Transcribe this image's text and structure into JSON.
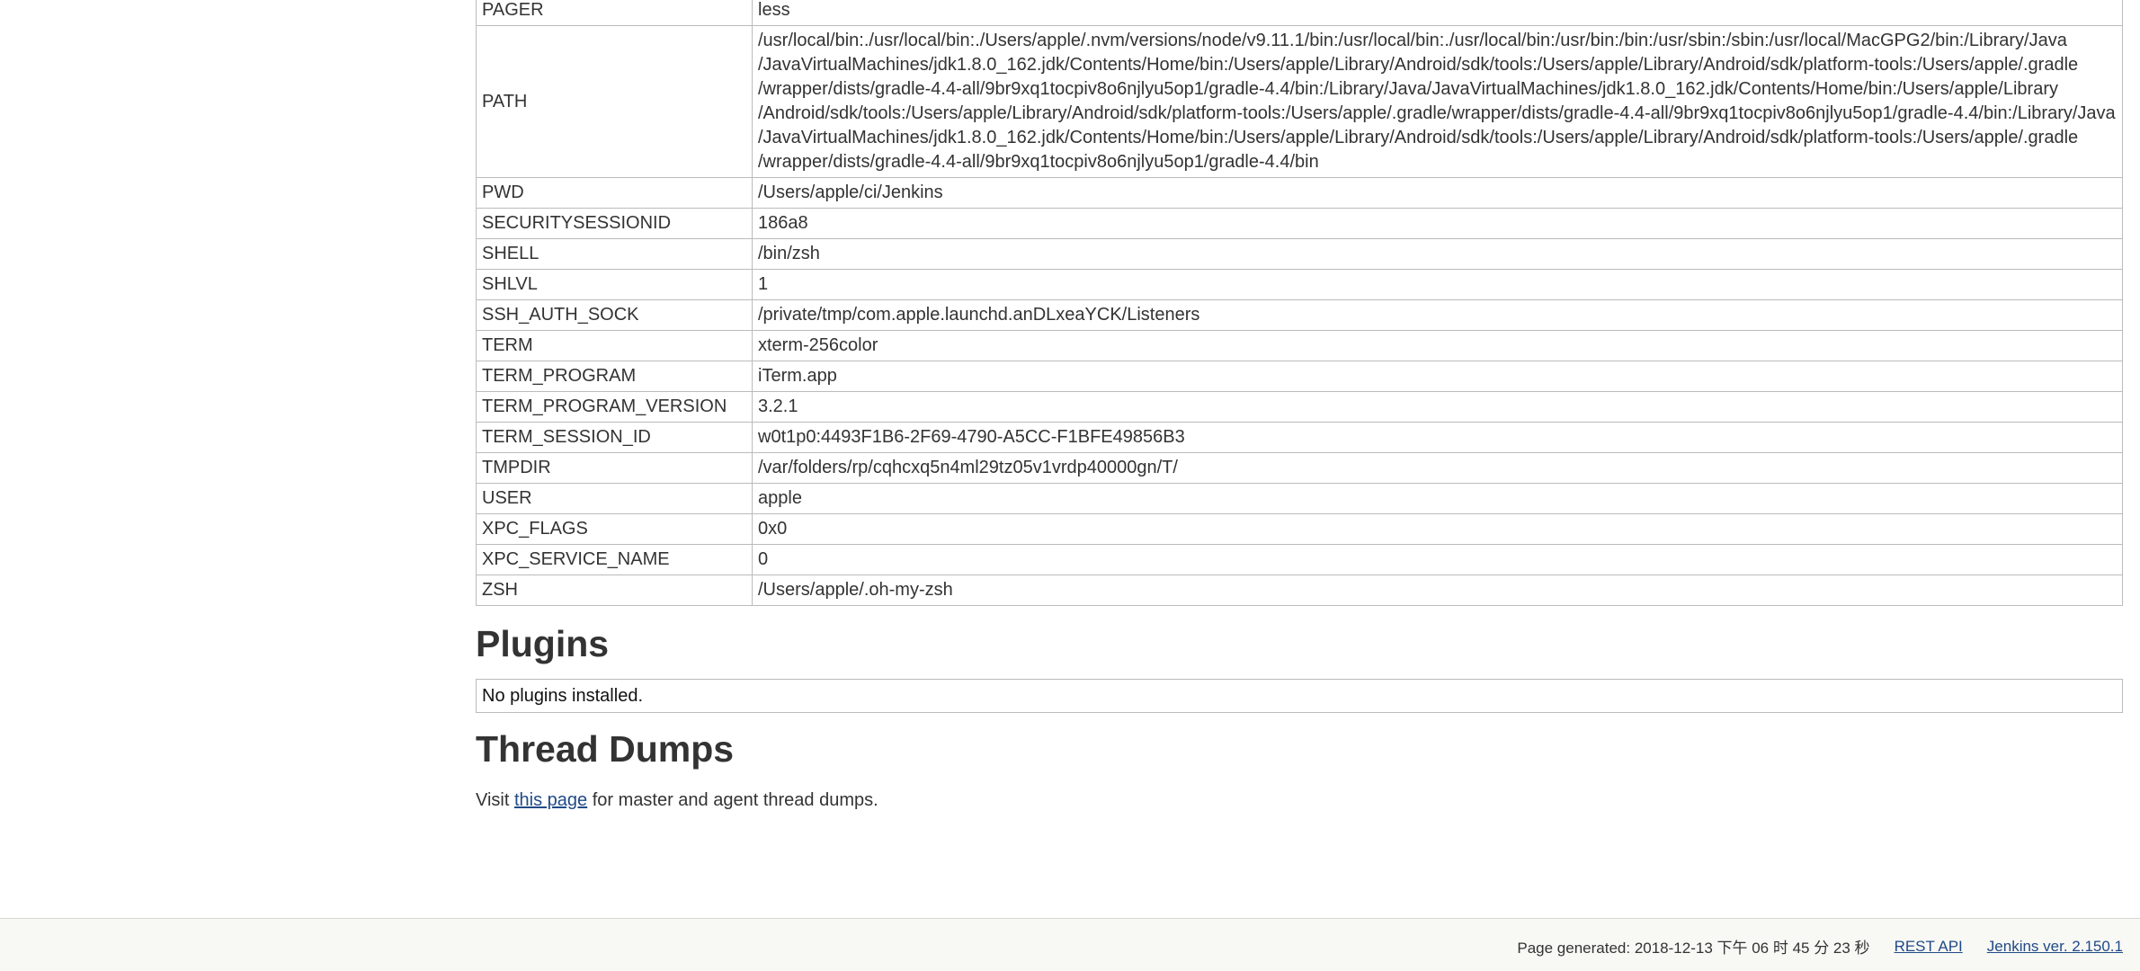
{
  "env_vars": [
    {
      "name": "PAGER",
      "value": [
        "less"
      ]
    },
    {
      "name": "PATH",
      "value": [
        "/usr/local/bin:./usr/local/bin:./Users/apple/.nvm/versions/node/v9.11.1/bin:/usr/local/bin:./usr/local/bin:/usr/bin:/bin:/usr/sbin:/sbin:/usr/local/MacGPG2/bin:/Library/Java",
        "/JavaVirtualMachines/jdk1.8.0_162.jdk/Contents/Home/bin:/Users/apple/Library/Android/sdk/tools:/Users/apple/Library/Android/sdk/platform-tools:/Users/apple/.gradle",
        "/wrapper/dists/gradle-4.4-all/9br9xq1tocpiv8o6njlyu5op1/gradle-4.4/bin:/Library/Java/JavaVirtualMachines/jdk1.8.0_162.jdk/Contents/Home/bin:/Users/apple/Library",
        "/Android/sdk/tools:/Users/apple/Library/Android/sdk/platform-tools:/Users/apple/.gradle/wrapper/dists/gradle-4.4-all/9br9xq1tocpiv8o6njlyu5op1/gradle-4.4/bin:/Library/Java",
        "/JavaVirtualMachines/jdk1.8.0_162.jdk/Contents/Home/bin:/Users/apple/Library/Android/sdk/tools:/Users/apple/Library/Android/sdk/platform-tools:/Users/apple/.gradle",
        "/wrapper/dists/gradle-4.4-all/9br9xq1tocpiv8o6njlyu5op1/gradle-4.4/bin"
      ]
    },
    {
      "name": "PWD",
      "value": [
        "/Users/apple/ci/Jenkins"
      ]
    },
    {
      "name": "SECURITYSESSIONID",
      "value": [
        "186a8"
      ]
    },
    {
      "name": "SHELL",
      "value": [
        "/bin/zsh"
      ]
    },
    {
      "name": "SHLVL",
      "value": [
        "1"
      ]
    },
    {
      "name": "SSH_AUTH_SOCK",
      "value": [
        "/private/tmp/com.apple.launchd.anDLxeaYCK/Listeners"
      ]
    },
    {
      "name": "TERM",
      "value": [
        "xterm-256color"
      ]
    },
    {
      "name": "TERM_PROGRAM",
      "value": [
        "iTerm.app"
      ]
    },
    {
      "name": "TERM_PROGRAM_VERSION",
      "value": [
        "3.2.1"
      ]
    },
    {
      "name": "TERM_SESSION_ID",
      "value": [
        "w0t1p0:4493F1B6-2F69-4790-A5CC-F1BFE49856B3"
      ]
    },
    {
      "name": "TMPDIR",
      "value": [
        "/var/folders/rp/cqhcxq5n4ml29tz05v1vrdp40000gn/T/"
      ]
    },
    {
      "name": "USER",
      "value": [
        "apple"
      ]
    },
    {
      "name": "XPC_FLAGS",
      "value": [
        "0x0"
      ]
    },
    {
      "name": "XPC_SERVICE_NAME",
      "value": [
        "0"
      ]
    },
    {
      "name": "ZSH",
      "value": [
        "/Users/apple/.oh-my-zsh"
      ]
    }
  ],
  "plugins": {
    "heading": "Plugins",
    "empty_message": "No plugins installed."
  },
  "thread_dumps": {
    "heading": "Thread Dumps",
    "text_before": "Visit ",
    "link_label": "this page",
    "text_after": " for master and agent thread dumps."
  },
  "footer": {
    "generated": "Page generated: 2018-12-13 下午 06 时 45 分 23 秒",
    "rest_api": "REST API",
    "version": "Jenkins ver. 2.150.1"
  },
  "colors": {
    "link": "#204a87",
    "footer_bg": "#f8f8f5",
    "table_border": "#bbbbbb"
  }
}
